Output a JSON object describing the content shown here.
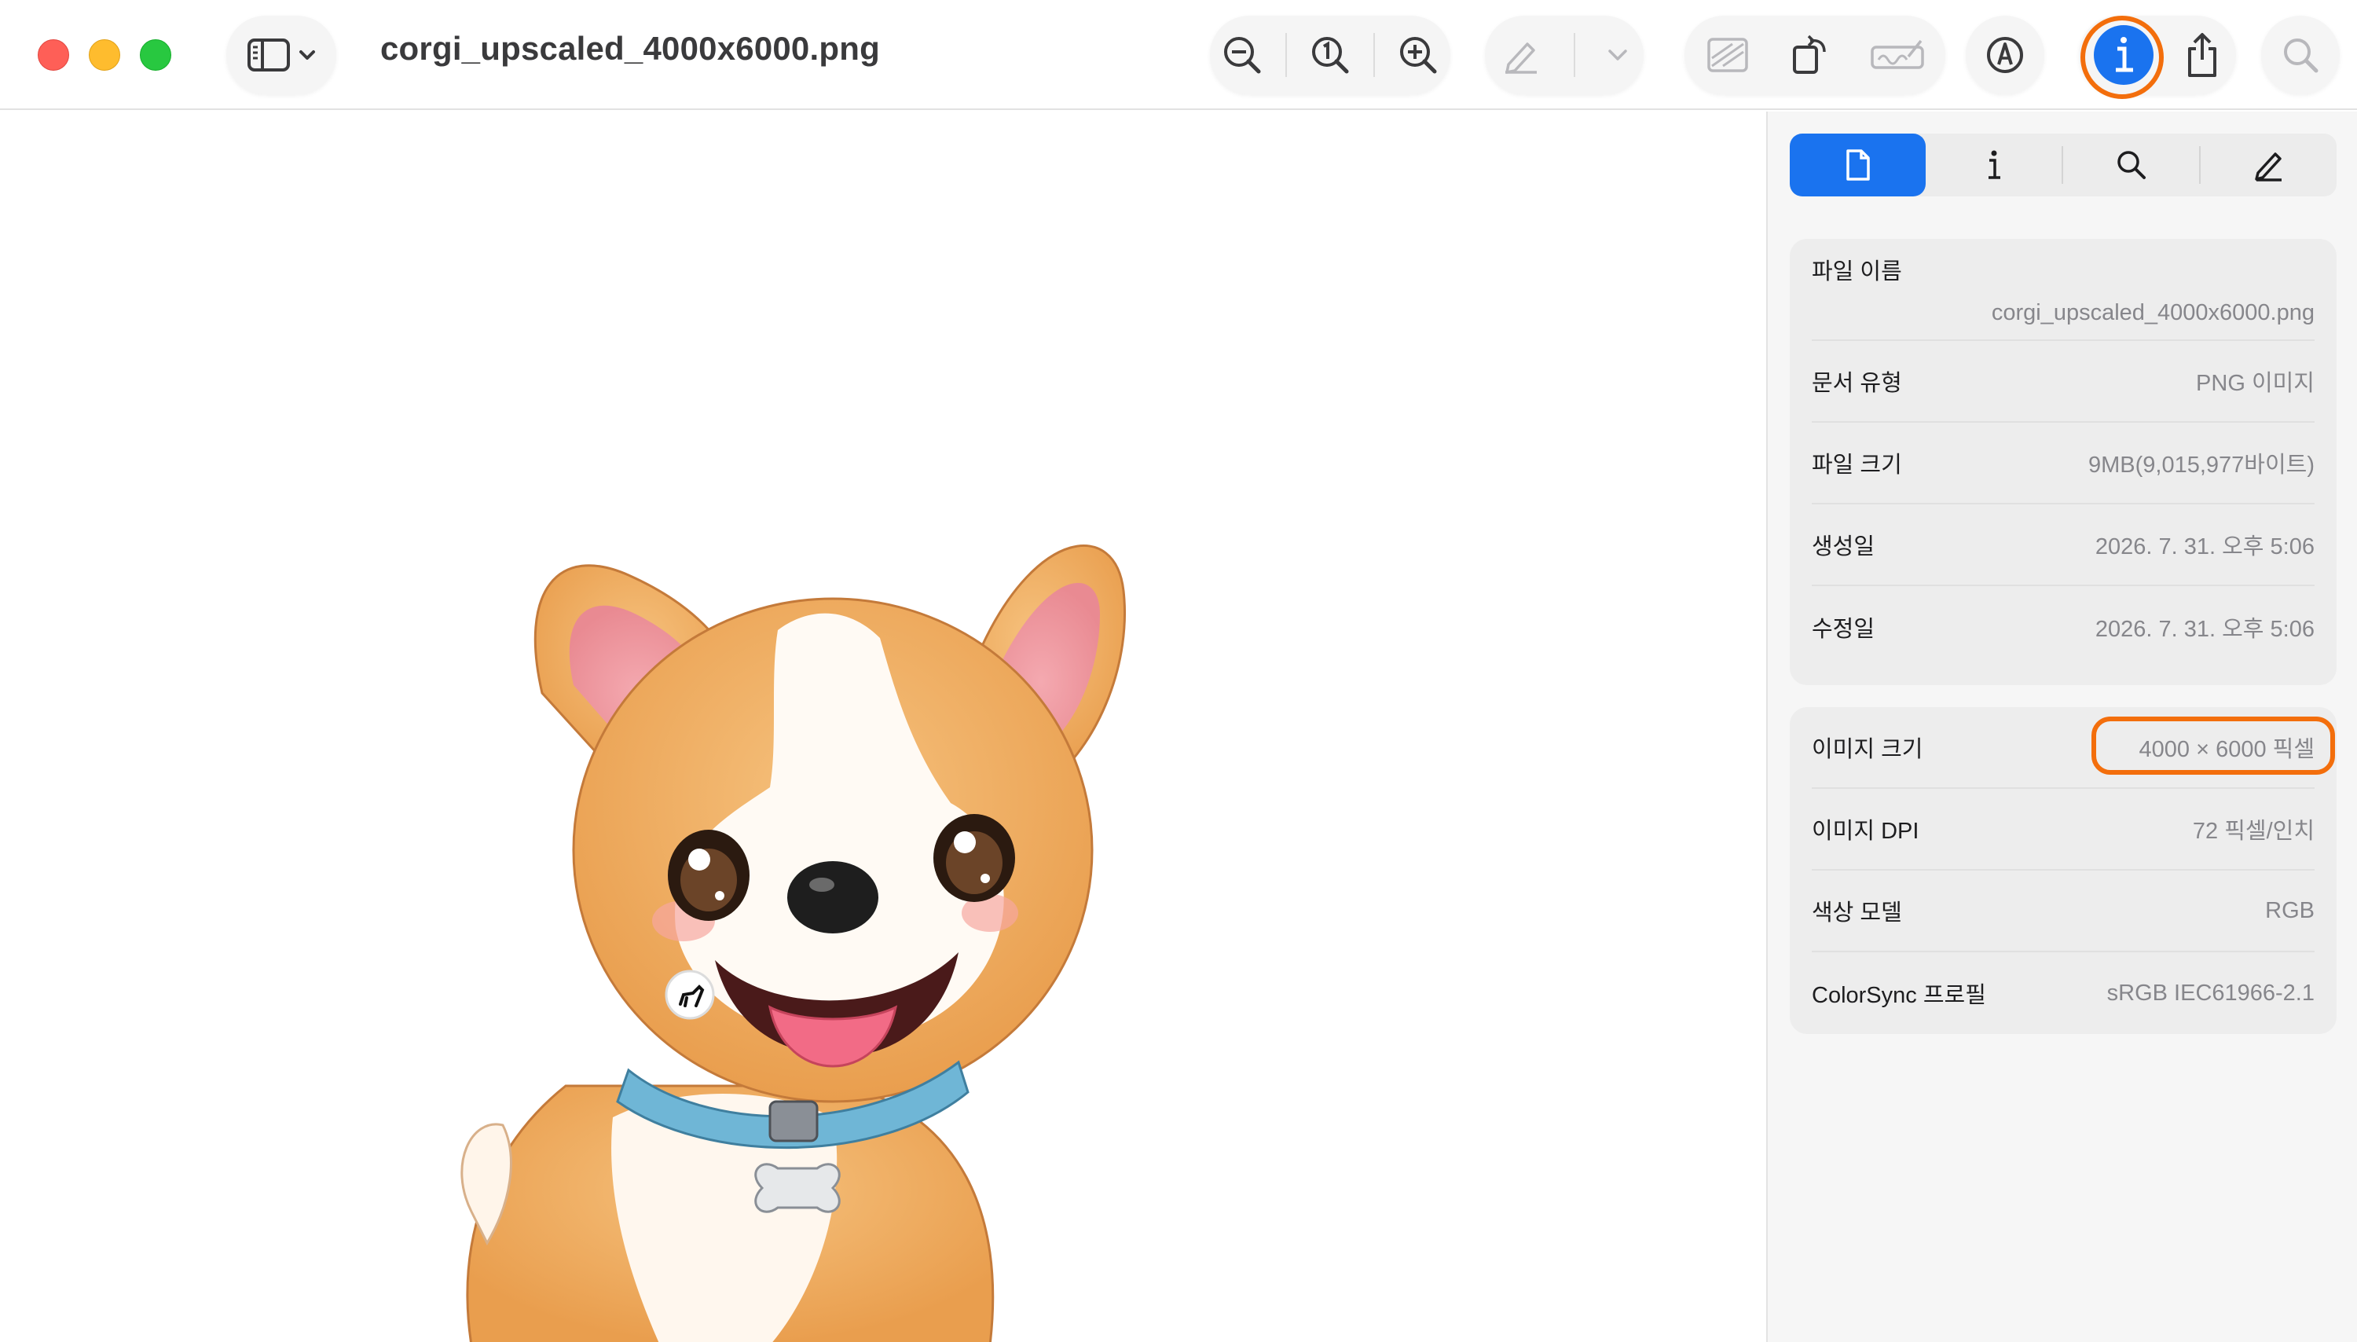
{
  "window": {
    "title": "corgi_upscaled_4000x6000.png"
  },
  "toolbar": {
    "icons": [
      "sidebar-icon",
      "chevron-down-icon",
      "zoom-out-icon",
      "actual-size-icon",
      "zoom-in-icon",
      "markup-pen-icon",
      "chevron-down-icon",
      "adjust-size-icon",
      "rotate-icon",
      "signature-icon",
      "markup-icon",
      "info-icon",
      "share-icon",
      "search-icon"
    ],
    "highlight_color": "#f36e0c",
    "active_color": "#1a73ef"
  },
  "inspector": {
    "tabs": [
      "document-icon",
      "info-icon",
      "search-icon",
      "pen-icon"
    ],
    "file_group": [
      {
        "label": "파일 이름",
        "value": "corgi_upscaled_4000x6000.png"
      },
      {
        "label": "문서 유형",
        "value": "PNG 이미지"
      },
      {
        "label": "파일 크기",
        "value": "9MB(9,015,977바이트)"
      },
      {
        "label": "생성일",
        "value": "2026. 7. 31. 오후 5:06"
      },
      {
        "label": "수정일",
        "value": "2026. 7. 31. 오후 5:06"
      }
    ],
    "image_group": [
      {
        "label": "이미지 크기",
        "value": "4000 × 6000 픽셀"
      },
      {
        "label": "이미지 DPI",
        "value": "72 픽셀/인치"
      },
      {
        "label": "색상 모델",
        "value": "RGB"
      },
      {
        "label": "ColorSync 프로필",
        "value": "sRGB IEC61966-2.1"
      }
    ]
  }
}
